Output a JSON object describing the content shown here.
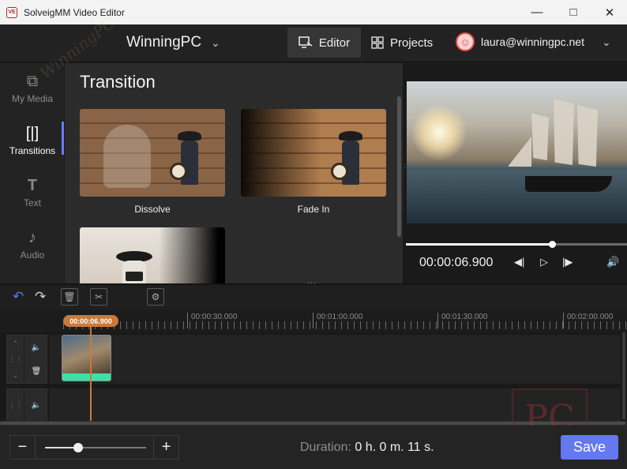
{
  "window": {
    "title": "SolveigMM Video Editor",
    "icon_text": "VE"
  },
  "header": {
    "workspace": "WinningPC",
    "editor_label": "Editor",
    "projects_label": "Projects",
    "user_email": "laura@winningpc.net"
  },
  "nav": {
    "items": [
      {
        "label": "My Media",
        "icon": "media-icon"
      },
      {
        "label": "Transitions",
        "icon": "transitions-icon",
        "active": true
      },
      {
        "label": "Text",
        "icon": "text-icon"
      },
      {
        "label": "Audio",
        "icon": "audio-icon"
      }
    ]
  },
  "panel": {
    "title": "Transition",
    "tiles": [
      {
        "label": "Dissolve"
      },
      {
        "label": "Fade In"
      },
      {
        "label": ""
      }
    ]
  },
  "preview": {
    "timecode": "00:00:06.900",
    "progress": 0.66
  },
  "timeline": {
    "playhead_time": "00:00:06.900",
    "ruler_labels": [
      "00:00:30.000",
      "00:01:00.000",
      "00:01:30.000",
      "00:02:00.000"
    ]
  },
  "footer": {
    "zoom_level": 0.33,
    "duration_label": "Duration:",
    "duration_value": "0 h. 0 m. 11 s.",
    "save_label": "Save"
  },
  "watermark": {
    "text": "PC",
    "diagonal_text": "WinningPC"
  },
  "colors": {
    "accent": "#6478f0",
    "playhead": "#c97a3a",
    "clip_audio": "#3ee0a8"
  }
}
